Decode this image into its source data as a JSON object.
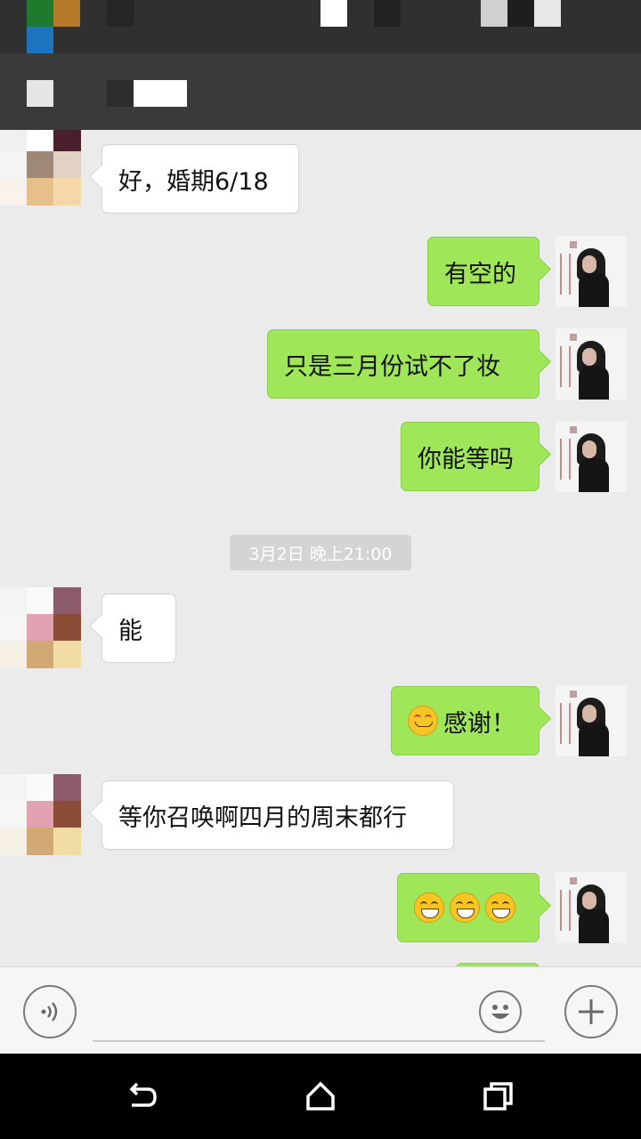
{
  "messages": [
    {
      "side": "in",
      "text": "好，婚期6/18"
    },
    {
      "side": "out",
      "text": "有空的"
    },
    {
      "side": "out",
      "text": "只是三月份试不了妆"
    },
    {
      "side": "out",
      "text": "你能等吗"
    },
    {
      "side": "in",
      "text": "能"
    },
    {
      "side": "out",
      "emoji": "smiling-blush-emoji",
      "text": "感谢！"
    },
    {
      "side": "in",
      "text": "等你召唤啊四月的周末都行"
    },
    {
      "side": "out",
      "emoji": [
        "grin-emoji",
        "grin-emoji",
        "grin-emoji"
      ]
    }
  ],
  "timestamp": "3月2日 晚上21:00",
  "colors": {
    "outgoing_bubble": "#9fe659",
    "incoming_bubble": "#ffffff",
    "chat_background": "#ebebeb"
  },
  "icons": {
    "voice": "voice-icon",
    "emoji": "emoji-icon",
    "plus": "plus-icon",
    "back": "back-icon",
    "home": "home-icon",
    "recents": "recents-icon"
  }
}
